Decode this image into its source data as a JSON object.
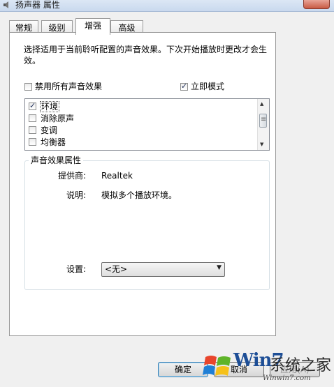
{
  "window": {
    "title": "扬声器 属性"
  },
  "tabs": [
    {
      "label": "常规"
    },
    {
      "label": "级别"
    },
    {
      "label": "增强"
    },
    {
      "label": "高级"
    }
  ],
  "enhancements": {
    "description": "选择适用于当前聆听配置的声音效果。下次开始播放时更改才会生效。",
    "disable_all": {
      "label": "禁用所有声音效果",
      "checked": false
    },
    "immediate_mode": {
      "label": "立即模式",
      "checked": true
    },
    "items": [
      {
        "label": "环境",
        "checked": true
      },
      {
        "label": "消除原声",
        "checked": false
      },
      {
        "label": "变调",
        "checked": false
      },
      {
        "label": "均衡器",
        "checked": false
      }
    ]
  },
  "properties": {
    "title": "声音效果属性",
    "provider_label": "提供商:",
    "provider_value": "Realtek",
    "description_label": "说明:",
    "description_value": "模拟多个播放环境。",
    "setting_label": "设置:",
    "setting_value": "<无>"
  },
  "buttons": {
    "ok": "确定",
    "cancel": "取消",
    "apply": "应用(A)"
  },
  "watermark": {
    "text": "Win7",
    "brand": "系统之家",
    "url": "Winwin7.com"
  }
}
